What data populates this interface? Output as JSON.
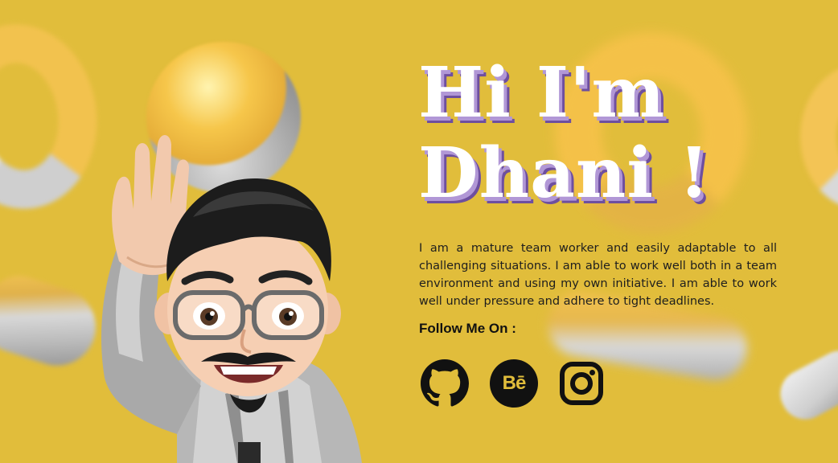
{
  "hero": {
    "title_line1": "Hi I'm",
    "title_line2": "Dhani !",
    "bio": "I am a mature team worker and easily adaptable to all challenging situations. I am able to work well both in a team environment and using my own initiative. I am able to work well under pressure and adhere to tight deadlines.",
    "follow_label": "Follow Me On :"
  },
  "social": [
    {
      "name": "GitHub",
      "icon": "github-icon"
    },
    {
      "name": "Behance",
      "icon": "behance-icon",
      "glyph": "Bē"
    },
    {
      "name": "Instagram",
      "icon": "instagram-icon"
    }
  ],
  "colors": {
    "background": "#e1bd3b",
    "title_text": "#ffffff",
    "title_shadow_light": "#b197d6",
    "title_shadow_dark": "#6e4f9f",
    "body_text": "#1e1e1e",
    "icon": "#111111"
  }
}
